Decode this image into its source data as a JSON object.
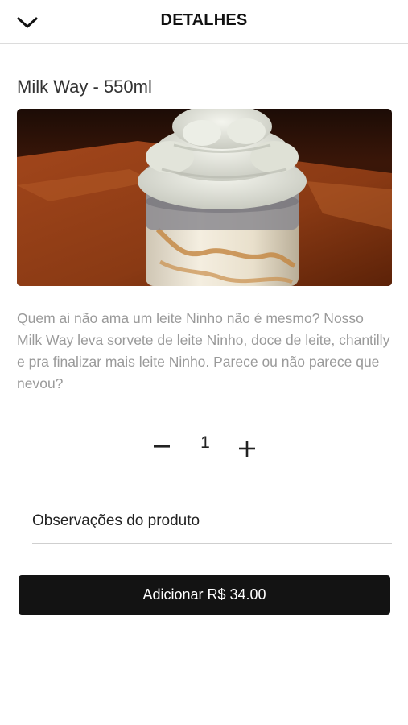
{
  "header": {
    "title": "DETALHES",
    "back_icon": "chevron-down-icon"
  },
  "product": {
    "name": "Milk Way - 550ml",
    "image": "milkshake-photo",
    "description": "Quem ai não ama um leite Ninho não é mesmo? Nosso Milk Way leva sorvete de leite Ninho, doce de leite, chantilly e pra finalizar mais leite Ninho. Parece ou não parece que nevou?"
  },
  "quantity": {
    "minus_label": "−",
    "value": "1",
    "plus_icon": "plus-icon"
  },
  "observations": {
    "placeholder": "Observações do produto",
    "value": ""
  },
  "add_button": {
    "label": "Adicionar R$ 34.00"
  },
  "colors": {
    "button_bg": "#131313",
    "description_text": "#9a9a9a",
    "divider": "#dcdcdc"
  }
}
